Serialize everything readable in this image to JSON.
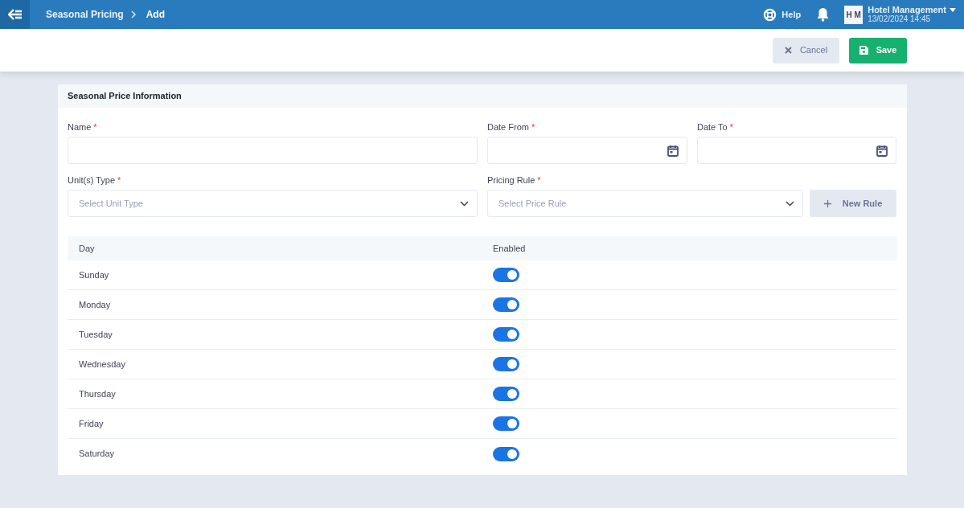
{
  "topbar": {
    "breadcrumb": [
      "Seasonal Pricing",
      "Add"
    ],
    "help": "Help",
    "avatar": "H M",
    "user": "Hotel Management",
    "datetime": "13/02/2024 14:45"
  },
  "actions": {
    "cancel": "Cancel",
    "save": "Save"
  },
  "section": {
    "title": "Seasonal Price Information"
  },
  "fields": [
    {
      "kind": "text",
      "label": "Name",
      "mark": "*"
    },
    {
      "kind": "date",
      "label": "Date From",
      "mark": "*"
    },
    {
      "kind": "date",
      "label": "Date To",
      "mark": "*"
    },
    {
      "kind": "select",
      "label": "Unit(s) Type",
      "mark": "*",
      "placeholder": "Select Unit Type"
    },
    {
      "kind": "select",
      "label": "Pricing Rule",
      "mark": "*",
      "placeholder": "Select Price Rule"
    }
  ],
  "new_rule": "New Rule",
  "table": {
    "columns": [
      "Day",
      "Enabled"
    ],
    "rows": [
      {
        "day": "Sunday",
        "on": true
      },
      {
        "day": "Monday",
        "on": true
      },
      {
        "day": "Tuesday",
        "on": true
      },
      {
        "day": "Wednesday",
        "on": true
      },
      {
        "day": "Thursday",
        "on": true
      },
      {
        "day": "Friday",
        "on": true
      },
      {
        "day": "Saturday",
        "on": true
      }
    ]
  }
}
